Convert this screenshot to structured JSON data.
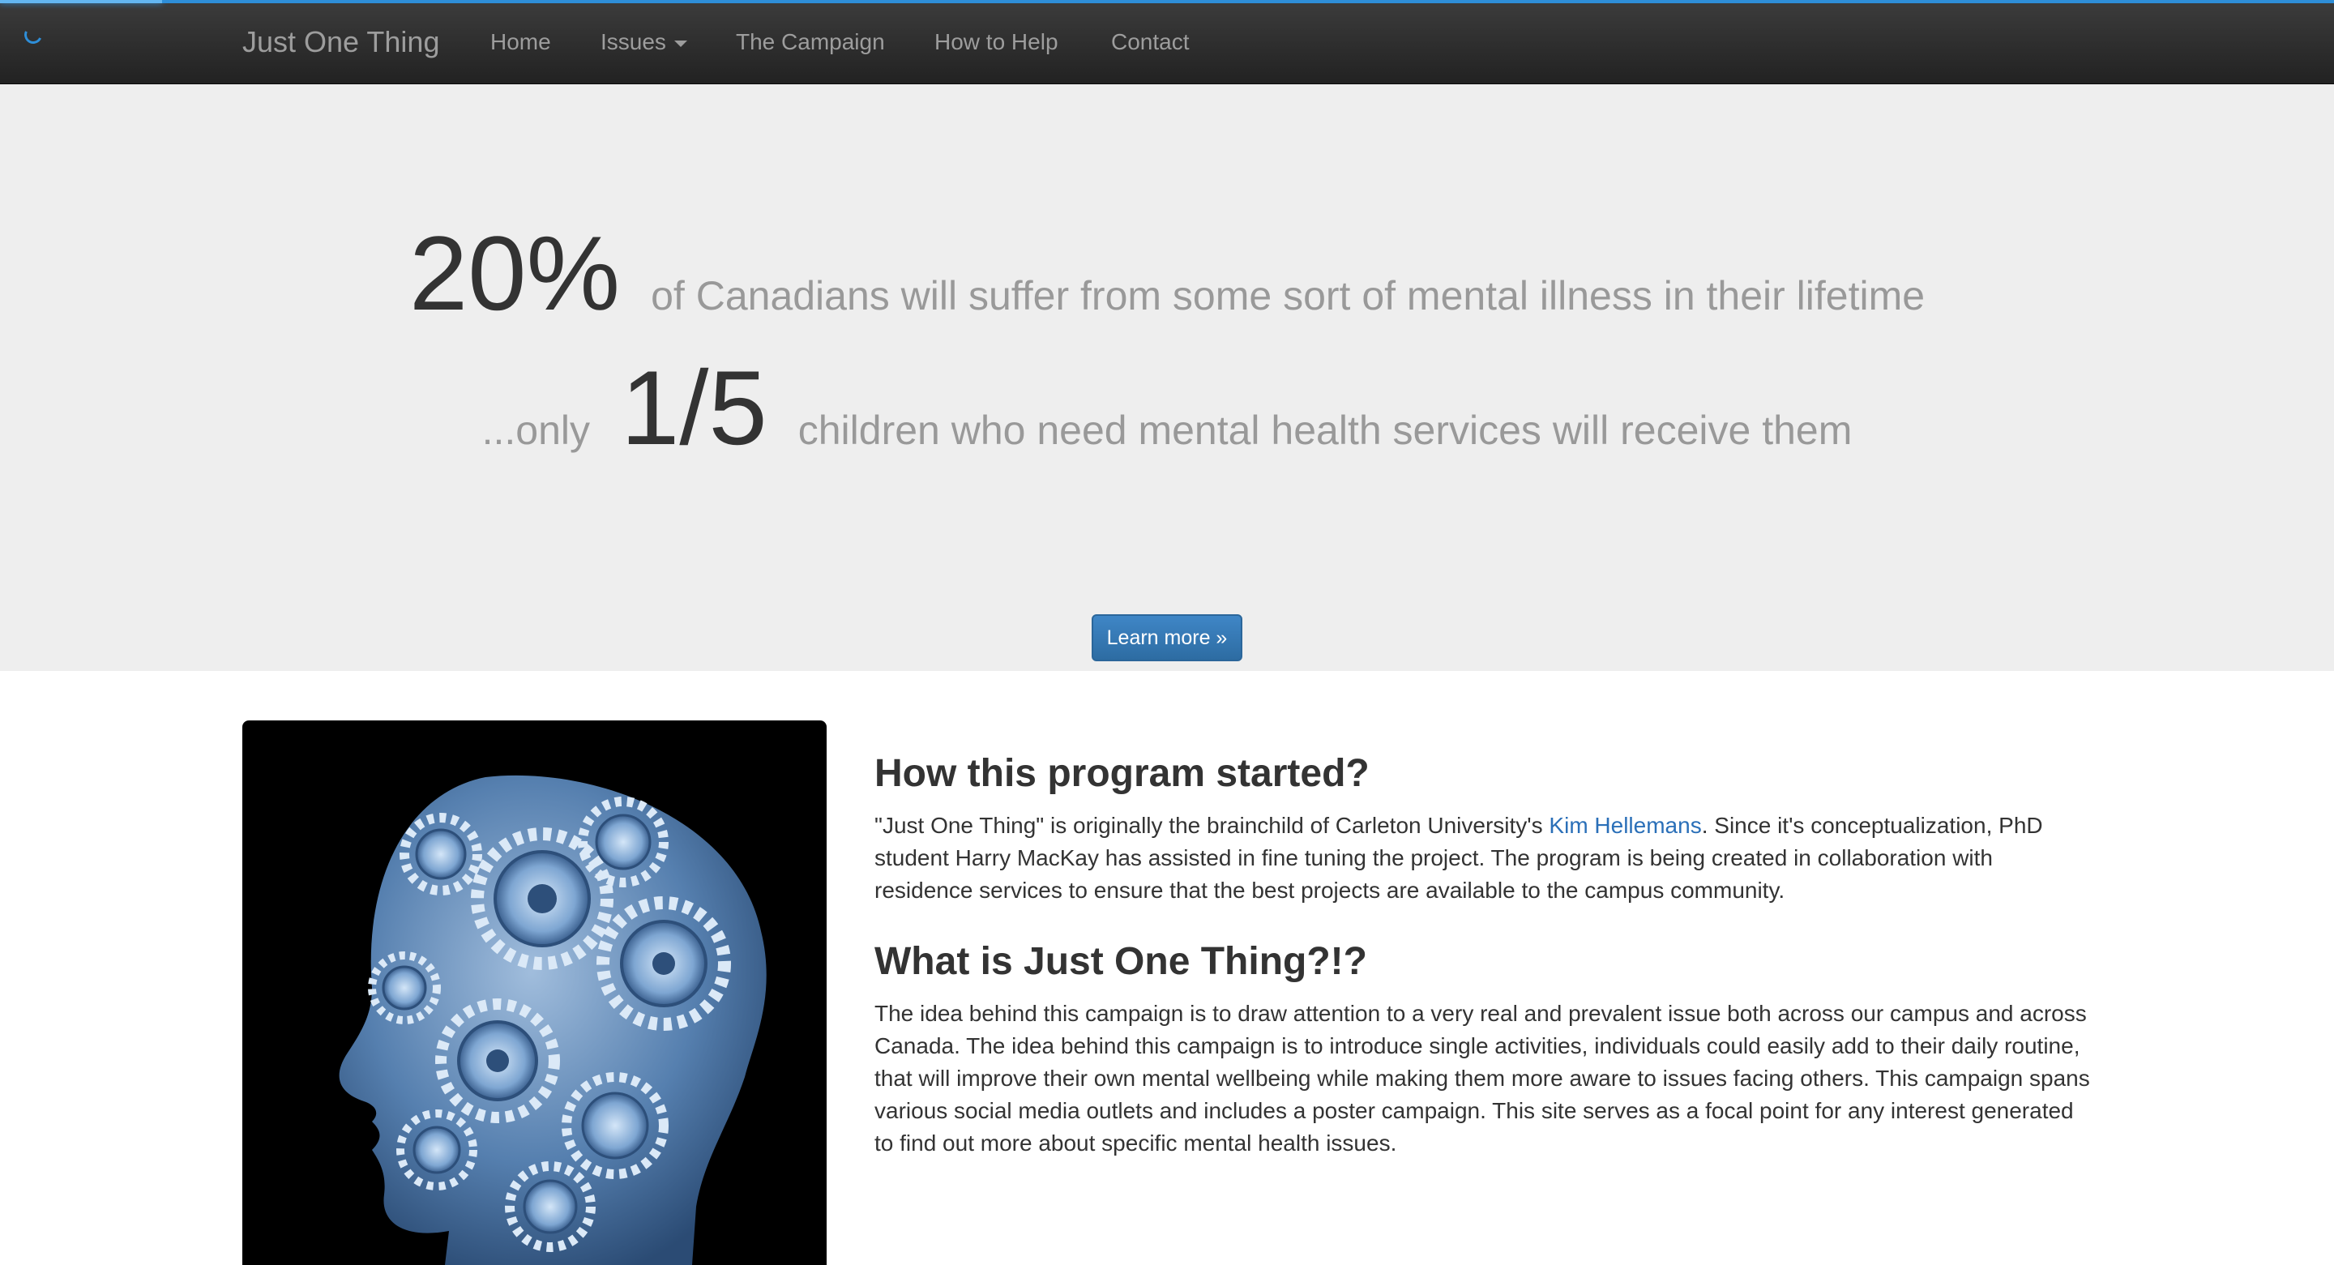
{
  "nav": {
    "brand": "Just One Thing",
    "links": [
      "Home",
      "Issues",
      "The Campaign",
      "How to Help",
      "Contact"
    ]
  },
  "hero": {
    "stat1_value": "20%",
    "stat1_text": "of Canadians will suffer from some sort of mental illness in their lifetime",
    "stat2_prefix": "...only",
    "stat2_value": "1/5",
    "stat2_text": "children who need mental health services will receive them",
    "button": "Learn more »"
  },
  "section1": {
    "heading": "How this program started?",
    "text_before_link": "\"Just One Thing\" is originally the brainchild of Carleton University's ",
    "link": "Kim Hellemans",
    "text_after_link": ". Since it's conceptualization, PhD student Harry MacKay has assisted in fine tuning the project. The program is being created in collaboration with residence services to ensure that the best projects are available to the campus community."
  },
  "section2": {
    "heading": "What is Just One Thing?!?",
    "text": "The idea behind this campaign is to draw attention to a very real and prevalent issue both across our campus and across Canada. The idea behind this campaign is to introduce single activities, individuals could easily add to their daily routine, that will improve their own mental wellbeing while making them more aware to issues facing others. This campaign spans various social media outlets and includes a poster campaign. This site serves as a focal point for any interest generated to find out more about specific mental health issues."
  },
  "colors": {
    "accent": "#2e8ed8",
    "navbar": "#222222",
    "jumbotron": "#eeeeee",
    "button": "#337ab7",
    "link": "#2a6fb8"
  },
  "icons": [
    "loading-spinner-icon",
    "caret-down-icon",
    "gear-head-image"
  ]
}
